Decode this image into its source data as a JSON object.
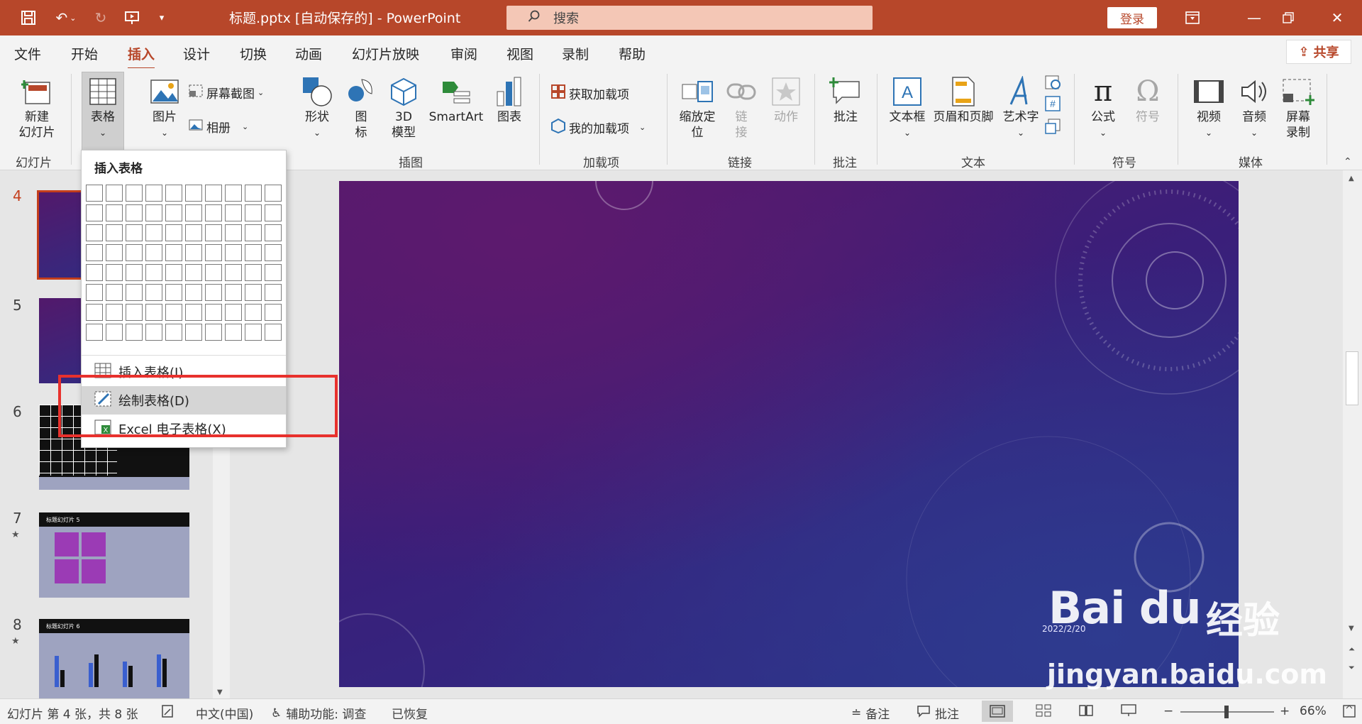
{
  "titlebar": {
    "doc_title": "标题.pptx [自动保存的]  -  PowerPoint",
    "search_placeholder": "搜索",
    "login": "登录"
  },
  "tabs": [
    "文件",
    "开始",
    "插入",
    "设计",
    "切换",
    "动画",
    "幻灯片放映",
    "审阅",
    "视图",
    "录制",
    "帮助"
  ],
  "active_tab": "插入",
  "share": "共享",
  "ribbon": {
    "new_slide": "新建\n幻灯片",
    "table": "表格",
    "picture": "图片",
    "screenshot": "屏幕截图",
    "album": "相册",
    "shapes": "形状",
    "icons": "图\n标",
    "model3d": "3D\n模型",
    "smartart": "SmartArt",
    "chart": "图表",
    "get_addins": "获取加载项",
    "my_addins": "我的加载项",
    "zoom": "缩放定\n位",
    "link": "链\n接",
    "action": "动作",
    "comment": "批注",
    "textbox": "文本框",
    "header_footer": "页眉和页脚",
    "wordart": "艺术字",
    "equation": "公式",
    "symbol": "符号",
    "video": "视频",
    "audio": "音频",
    "screen_record": "屏幕\n录制",
    "groups": {
      "slides": "幻灯片",
      "illustrations": "插图",
      "addins": "加载项",
      "links": "链接",
      "comments": "批注",
      "text": "文本",
      "symbols": "符号",
      "media": "媒体"
    }
  },
  "dropdown": {
    "header": "插入表格",
    "grid_cols": 10,
    "grid_rows": 8,
    "insert_table": "插入表格(I)...",
    "draw_table": "绘制表格(D)",
    "excel_table": "Excel 电子表格(X)"
  },
  "slides": [
    {
      "num": "4",
      "active": true
    },
    {
      "num": "5"
    },
    {
      "num": "6"
    },
    {
      "num": "7",
      "star": "★"
    },
    {
      "num": "8",
      "star": "★"
    }
  ],
  "thumb7_title": "标题幻灯片 5",
  "thumb8_title": "标题幻灯片 6",
  "slide": {
    "date": "2022/2/20"
  },
  "statusbar": {
    "slide_info": "幻灯片 第 4 张，共 8 张",
    "language": "中文(中国)",
    "accessibility": "辅助功能: 调查",
    "recovered": "已恢复",
    "notes": "备注",
    "comments": "批注",
    "zoom": "66%"
  },
  "watermark": {
    "brand": "Bai du",
    "brand_cn": "经验",
    "url": "jingyan.baidu.com"
  },
  "colors": {
    "accent": "#b7472a",
    "highlight_box": "#e8312d"
  }
}
